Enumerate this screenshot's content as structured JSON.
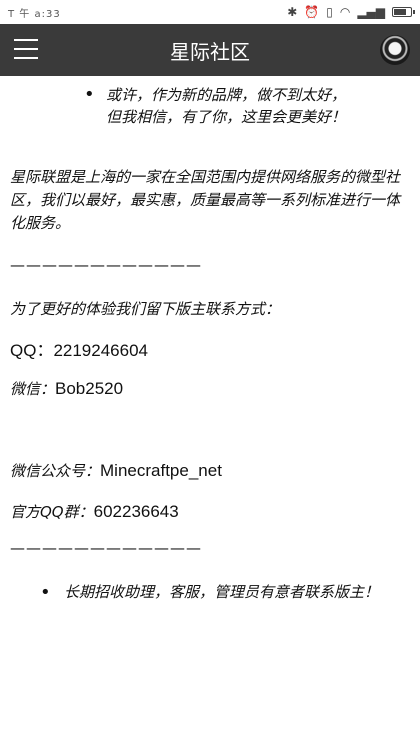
{
  "status_bar": {
    "left": "T 午 a:33",
    "battery_level": 0.8
  },
  "app_bar": {
    "title": "星际社区"
  },
  "content": {
    "bullet1": "或许，作为新的品牌，做不到太好，但我相信，有了你，这里会更美好！",
    "intro": "星际联盟是上海的一家在全国范围内提供网络服务的微型社区，我们以最好，最实惠，质量最高等一系列标准进行一体化服务。",
    "divider1": "————————————",
    "contact_intro": "为了更好的体验我们留下版主联系方式：",
    "qq_line": "QQ：2219246604",
    "wechat_label": "微信：",
    "wechat_value": "Bob2520",
    "public_label": "微信公众号：",
    "public_value": "Minecraftpe_net",
    "group_label": "官方QQ群：",
    "group_value": "602236643",
    "divider2": "————————————",
    "bullet2": "长期招收助理，客服，管理员有意者联系版主！"
  }
}
